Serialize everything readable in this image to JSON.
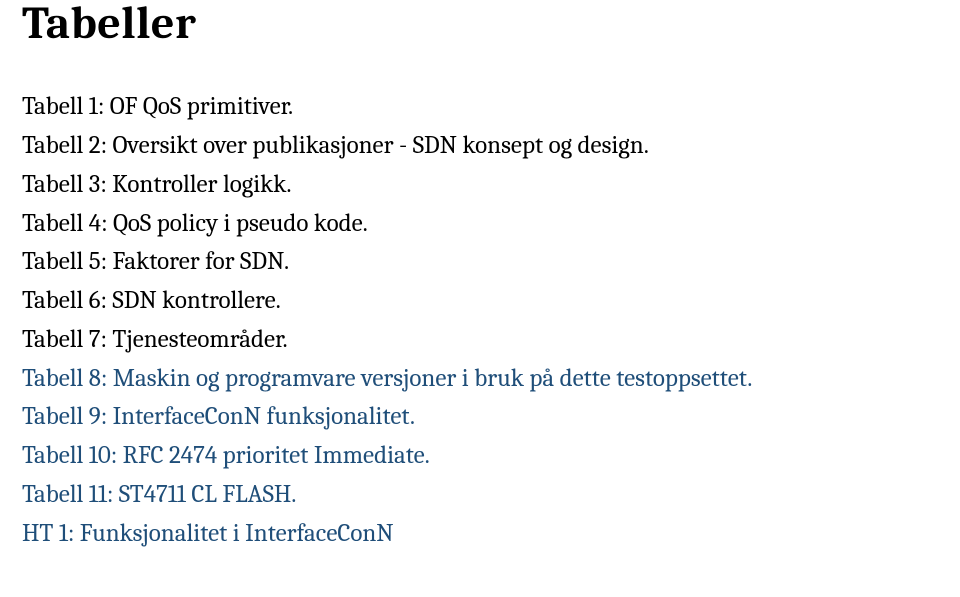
{
  "title": "Tabeller",
  "entries": [
    {
      "text": "Tabell 1: OF QoS primitiver.",
      "link": false
    },
    {
      "text": "Tabell 2: Oversikt over publikasjoner - SDN konsept og design.",
      "link": false
    },
    {
      "text": "Tabell 3: Kontroller logikk.",
      "link": false
    },
    {
      "text": "Tabell 4: QoS policy i pseudo kode.",
      "link": false
    },
    {
      "text": "Tabell 5: Faktorer for SDN.",
      "link": false
    },
    {
      "text": "Tabell 6: SDN kontrollere.",
      "link": false
    },
    {
      "text": "Tabell 7: Tjenesteområder.",
      "link": false
    },
    {
      "text": "Tabell 8: Maskin og programvare versjoner i bruk på dette testoppsettet.",
      "link": true
    },
    {
      "text": "Tabell 9: InterfaceConN funksjonalitet.",
      "link": true
    },
    {
      "text": "Tabell 10: RFC 2474 prioritet Immediate.",
      "link": true
    },
    {
      "text": "Tabell 11: ST4711 CL FLASH.",
      "link": true
    },
    {
      "text": "HT 1: Funksjonalitet i InterfaceConN",
      "link": true
    }
  ]
}
